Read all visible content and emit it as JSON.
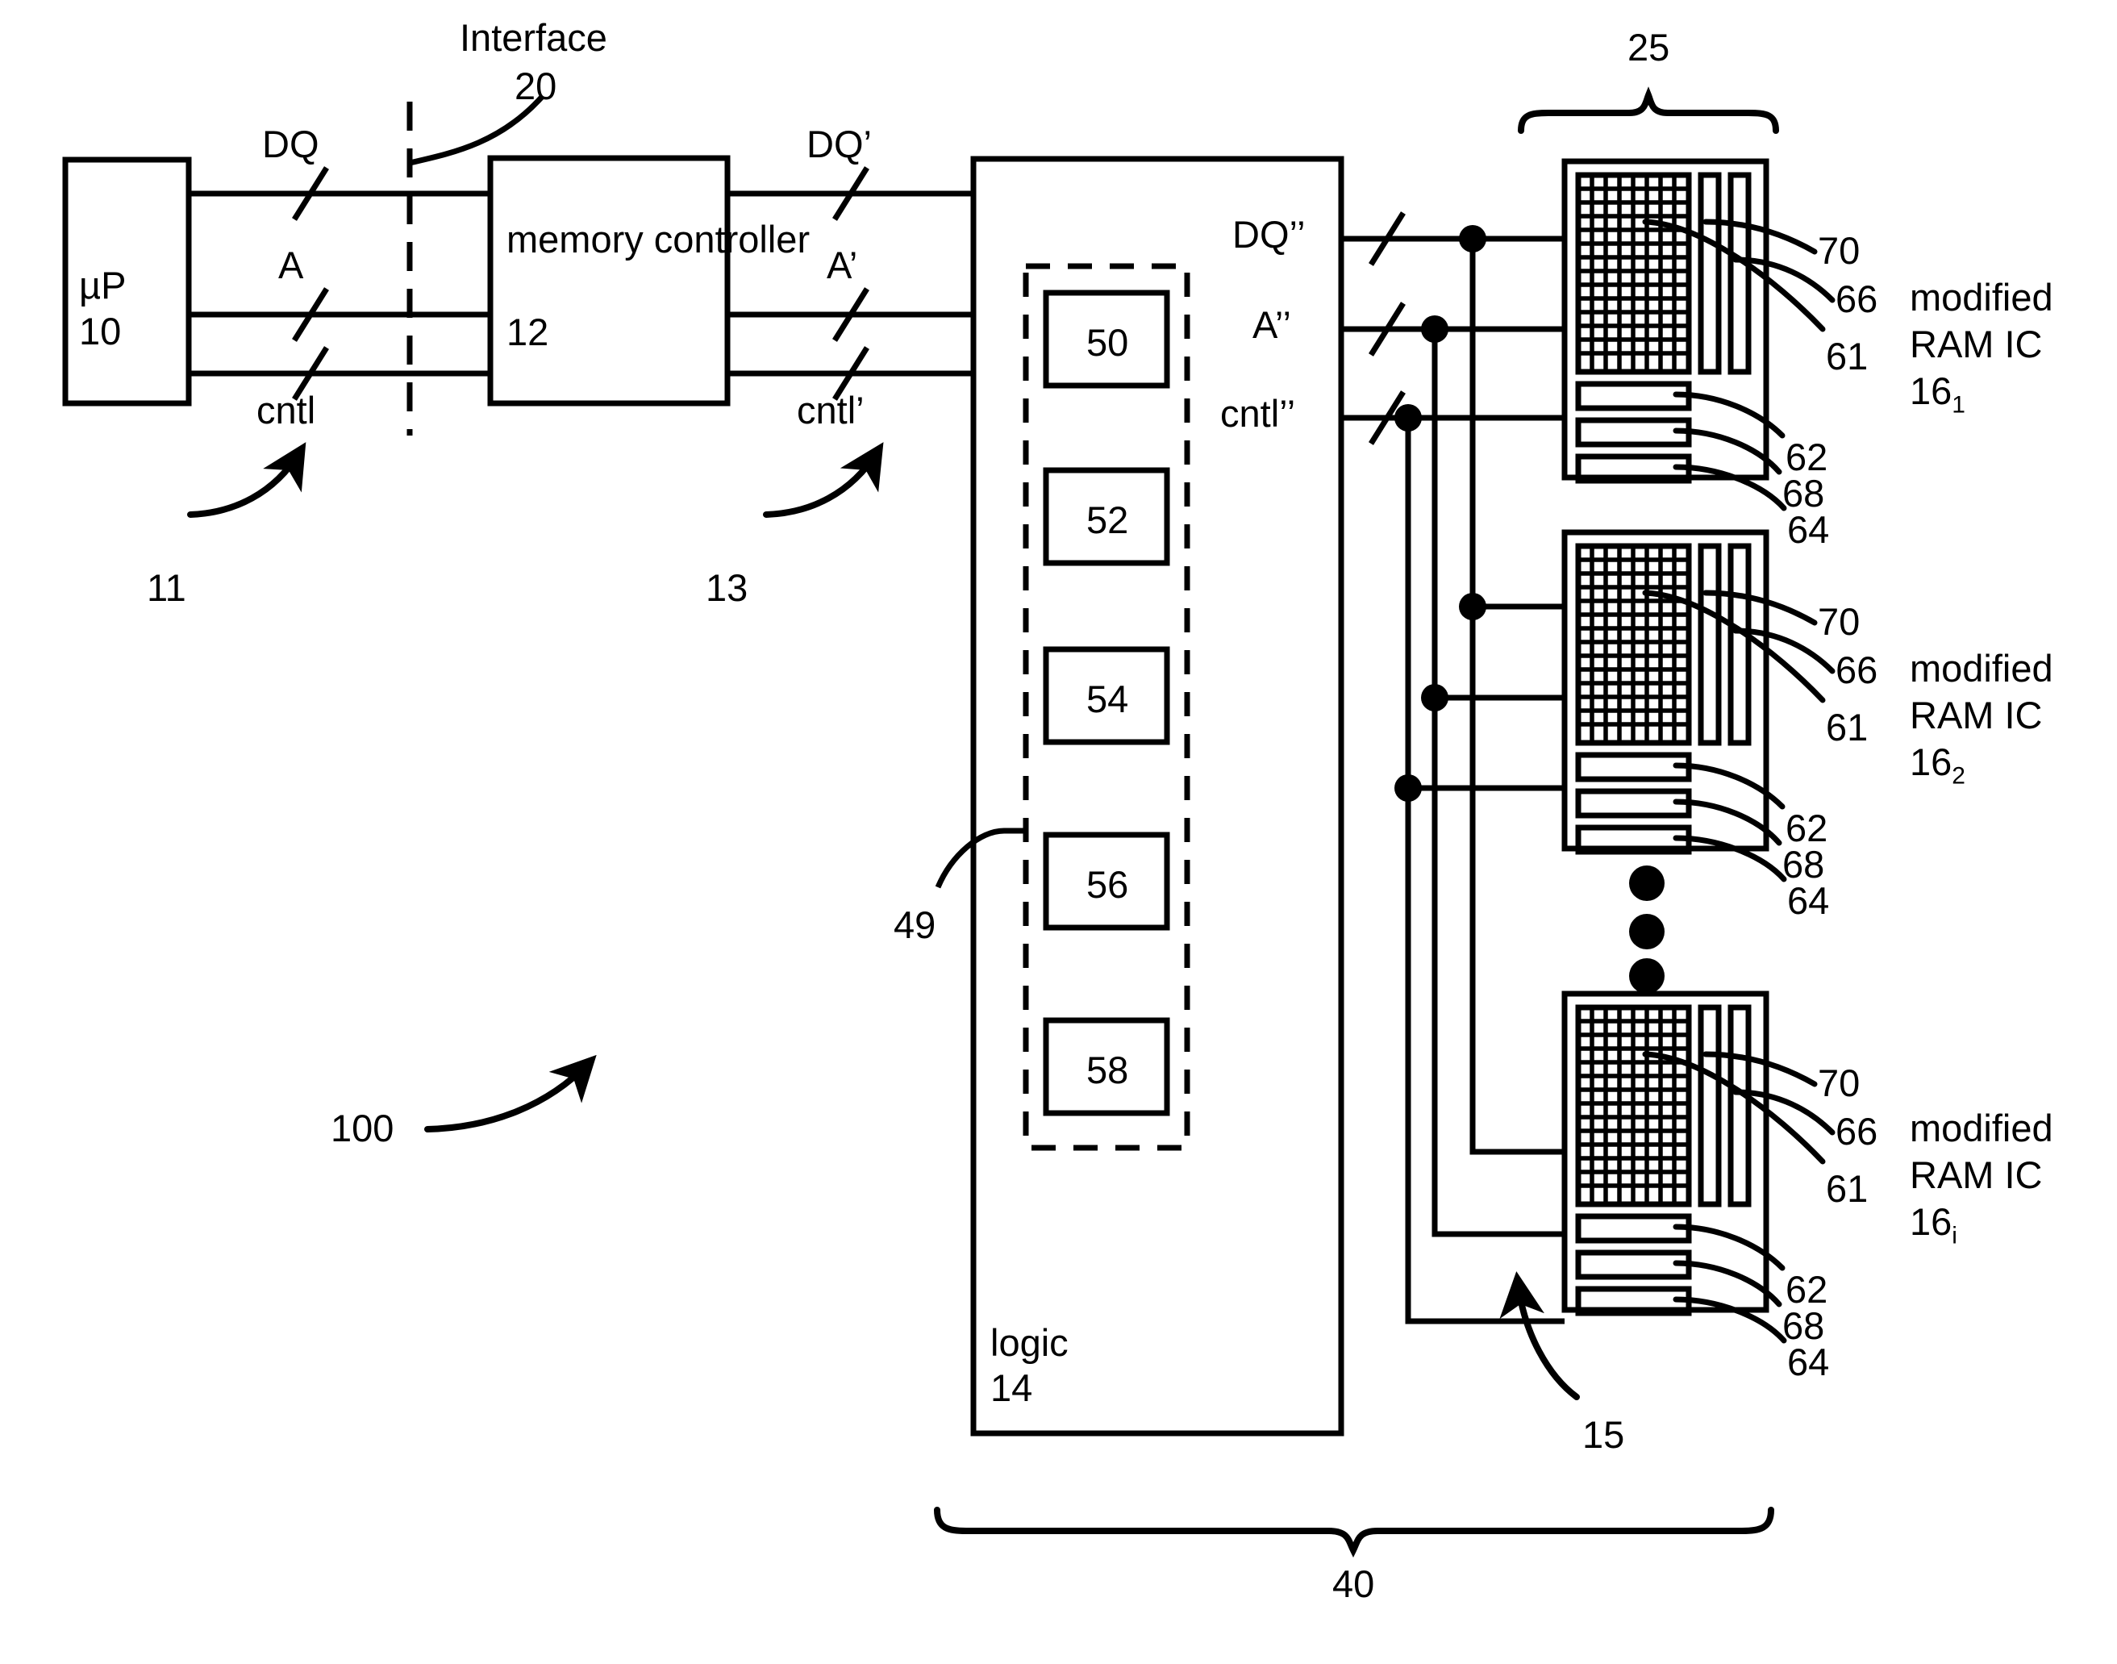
{
  "figure": {
    "kind": "patent-block-diagram",
    "system_label": "100",
    "interface_label": "Interface",
    "interface_ref": "20"
  },
  "blocks": {
    "microprocessor": {
      "name": "µP",
      "ref": "10"
    },
    "memory_controller": {
      "name": "memory controller",
      "ref": "12"
    },
    "logic": {
      "name": "logic",
      "ref": "14"
    }
  },
  "buses": {
    "mp_to_mc": [
      {
        "label": "DQ",
        "ref": ""
      },
      {
        "label": "A",
        "ref": ""
      },
      {
        "label": "cntl",
        "ref": ""
      }
    ],
    "mp_to_mc_ref": "11",
    "mc_to_logic": [
      {
        "label": "DQ’",
        "ref": ""
      },
      {
        "label": "A’",
        "ref": ""
      },
      {
        "label": "cntl’",
        "ref": ""
      }
    ],
    "mc_to_logic_ref": "13",
    "logic_to_ram": [
      {
        "label": "DQ’’",
        "ref": ""
      },
      {
        "label": "A’’",
        "ref": ""
      },
      {
        "label": "cntl’’",
        "ref": ""
      }
    ],
    "logic_to_ram_ref": "15"
  },
  "logic_inner": {
    "group_ref": "49",
    "modules": [
      "50",
      "52",
      "54",
      "56",
      "58"
    ]
  },
  "ram_ics": [
    {
      "title_line1": "modified",
      "title_line2": "RAM IC",
      "ref_base": "16",
      "ref_sub": "1",
      "callouts": [
        "70",
        "66",
        "61",
        "62",
        "68",
        "64"
      ]
    },
    {
      "title_line1": "modified",
      "title_line2": "RAM IC",
      "ref_base": "16",
      "ref_sub": "2",
      "callouts": [
        "70",
        "66",
        "61",
        "62",
        "68",
        "64"
      ]
    },
    {
      "title_line1": "modified",
      "title_line2": "RAM IC",
      "ref_base": "16",
      "ref_sub": "i",
      "callouts": [
        "70",
        "66",
        "61",
        "62",
        "68",
        "64"
      ]
    }
  ],
  "brackets": {
    "ram_group": "25",
    "module_group": "40"
  },
  "ellipsis": {
    "dots": 3
  },
  "colors": {
    "stroke": "#000000",
    "background": "#ffffff"
  }
}
